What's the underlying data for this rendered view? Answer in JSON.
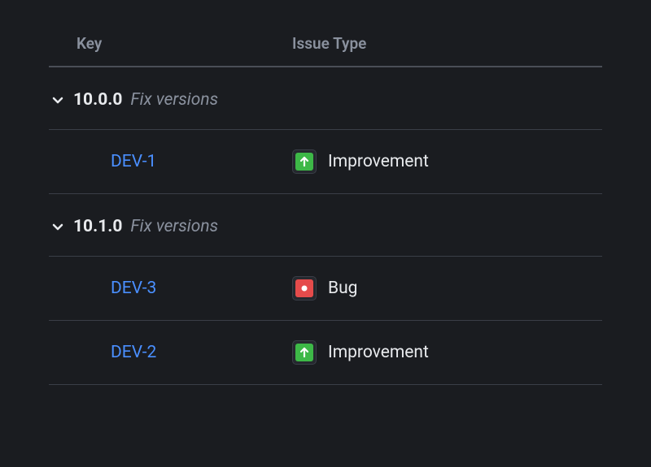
{
  "columns": {
    "key": "Key",
    "issueType": "Issue Type"
  },
  "groups": [
    {
      "version": "10.0.0",
      "subtitle": "Fix versions",
      "issues": [
        {
          "key": "DEV-1",
          "type": "Improvement",
          "typeKind": "improvement"
        }
      ]
    },
    {
      "version": "10.1.0",
      "subtitle": "Fix versions",
      "issues": [
        {
          "key": "DEV-3",
          "type": "Bug",
          "typeKind": "bug"
        },
        {
          "key": "DEV-2",
          "type": "Improvement",
          "typeKind": "improvement"
        }
      ]
    }
  ]
}
